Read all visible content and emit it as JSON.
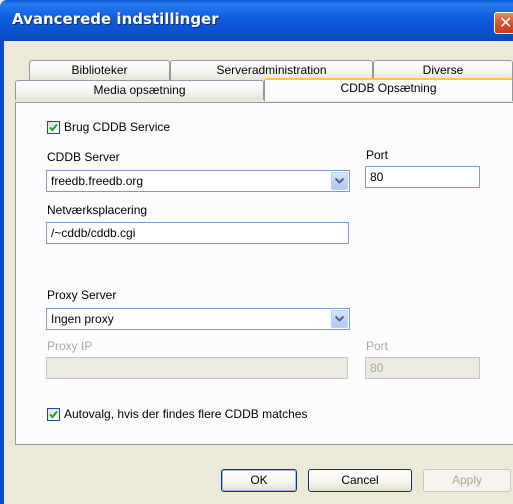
{
  "window": {
    "title": "Avancerede indstillinger",
    "close_glyph": "✕"
  },
  "tabs_row1": [
    {
      "label": "Biblioteker"
    },
    {
      "label": "Serveradministration"
    },
    {
      "label": "Diverse"
    }
  ],
  "tabs_row2": [
    {
      "label": "Media opsætning"
    },
    {
      "label": "CDDB Opsætning",
      "active": true
    }
  ],
  "cddb": {
    "use_service_label": "Brug CDDB Service",
    "use_service_checked": true,
    "server_label": "CDDB Server",
    "server_value": "freedb.freedb.org",
    "port_label": "Port",
    "port_value": "80",
    "location_label": "Netværksplacering",
    "location_value": "/~cddb/cddb.cgi"
  },
  "proxy": {
    "server_label": "Proxy Server",
    "server_value": "Ingen proxy",
    "ip_label": "Proxy IP",
    "ip_value": "",
    "port_label": "Port",
    "port_value": "80"
  },
  "autoselect": {
    "label": "Autovalg, hvis der findes flere CDDB matches",
    "checked": true
  },
  "buttons": {
    "ok": "OK",
    "cancel": "Cancel",
    "apply": "Apply"
  },
  "colors": {
    "titlebar": "#0b52cf",
    "tab_active_accent": "#ffc83c",
    "dialog_bg": "#ece9d8"
  }
}
